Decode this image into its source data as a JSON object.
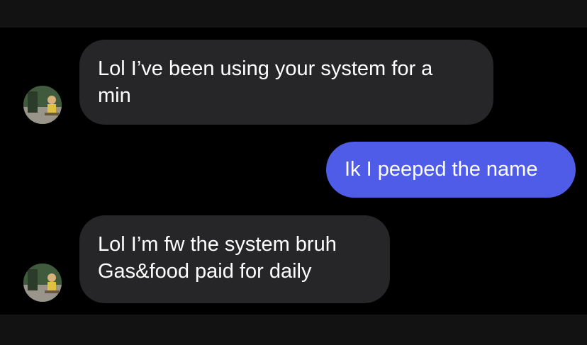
{
  "conversation": {
    "messages": [
      {
        "direction": "incoming",
        "lines": [
          "Lol I’ve been using your system for a",
          "min"
        ]
      },
      {
        "direction": "outgoing",
        "lines": [
          "Ik I peeped the name"
        ]
      },
      {
        "direction": "incoming",
        "lines": [
          "Lol I’m fw the system bruh",
          "Gas&food paid for daily"
        ]
      }
    ]
  },
  "colors": {
    "background": "#000000",
    "incoming_bubble": "#262628",
    "outgoing_bubble": "#4f5ce8",
    "text": "#ffffff"
  },
  "icons": {
    "sender_avatar": "contact-avatar"
  }
}
